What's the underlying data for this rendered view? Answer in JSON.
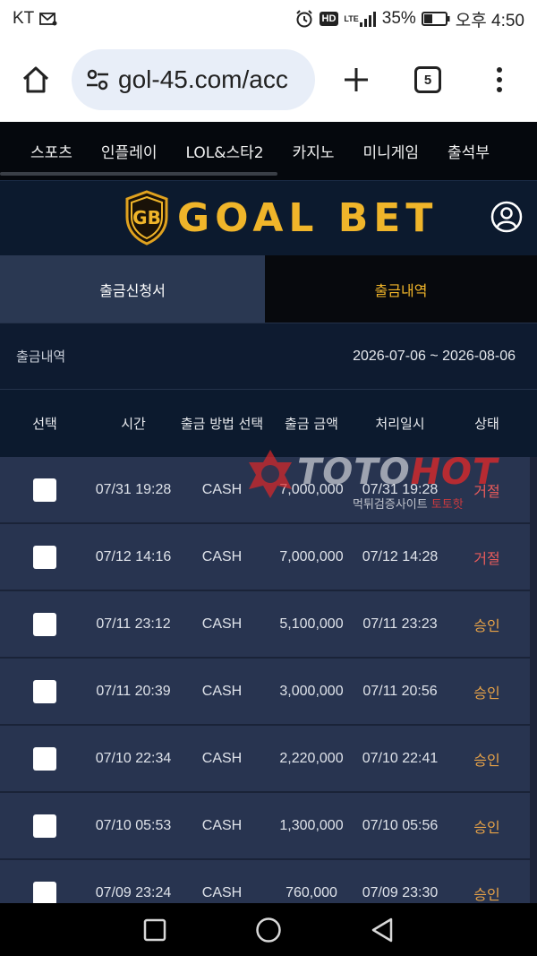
{
  "status_bar": {
    "carrier": "KT",
    "battery_percent": "35%",
    "network": "LTE",
    "hd": "HD",
    "time": "오후 4:50"
  },
  "browser": {
    "url": "gol-45.com/acc",
    "tab_count": "5"
  },
  "site_nav": {
    "items": [
      "스포츠",
      "인플레이",
      "LOL&스타2",
      "카지노",
      "미니게임",
      "출석부"
    ]
  },
  "logo": {
    "text": "GOAL BET",
    "color": "#f0b52a"
  },
  "tabs": {
    "request": "출금신청서",
    "history": "출금내역"
  },
  "info": {
    "label": "출금내역",
    "date_range": "2026-07-06 ~ 2026-08-06"
  },
  "table": {
    "headers": [
      "선택",
      "시간",
      "출금 방법 선택",
      "출금 금액",
      "처리일시",
      "상태"
    ],
    "rows": [
      {
        "time": "07/31 19:28",
        "method": "CASH",
        "amount": "7,000,000",
        "processed": "07/31 19:28",
        "status": "거절",
        "status_type": "rejected"
      },
      {
        "time": "07/12 14:16",
        "method": "CASH",
        "amount": "7,000,000",
        "processed": "07/12 14:28",
        "status": "거절",
        "status_type": "rejected"
      },
      {
        "time": "07/11 23:12",
        "method": "CASH",
        "amount": "5,100,000",
        "processed": "07/11 23:23",
        "status": "승인",
        "status_type": "approved"
      },
      {
        "time": "07/11 20:39",
        "method": "CASH",
        "amount": "3,000,000",
        "processed": "07/11 20:56",
        "status": "승인",
        "status_type": "approved"
      },
      {
        "time": "07/10 22:34",
        "method": "CASH",
        "amount": "2,220,000",
        "processed": "07/10 22:41",
        "status": "승인",
        "status_type": "approved"
      },
      {
        "time": "07/10 05:53",
        "method": "CASH",
        "amount": "1,300,000",
        "processed": "07/10 05:56",
        "status": "승인",
        "status_type": "approved"
      },
      {
        "time": "07/09 23:24",
        "method": "CASH",
        "amount": "760,000",
        "processed": "07/09 23:30",
        "status": "승인",
        "status_type": "approved"
      }
    ]
  },
  "watermark": {
    "toto": "TOTO",
    "hot": "HOT",
    "sub_a": "먹튀검증사이트",
    "sub_b": "토토핫"
  },
  "colors": {
    "rejected": "#e85b5b",
    "approved": "#e9a347",
    "accent": "#f0b52a"
  }
}
